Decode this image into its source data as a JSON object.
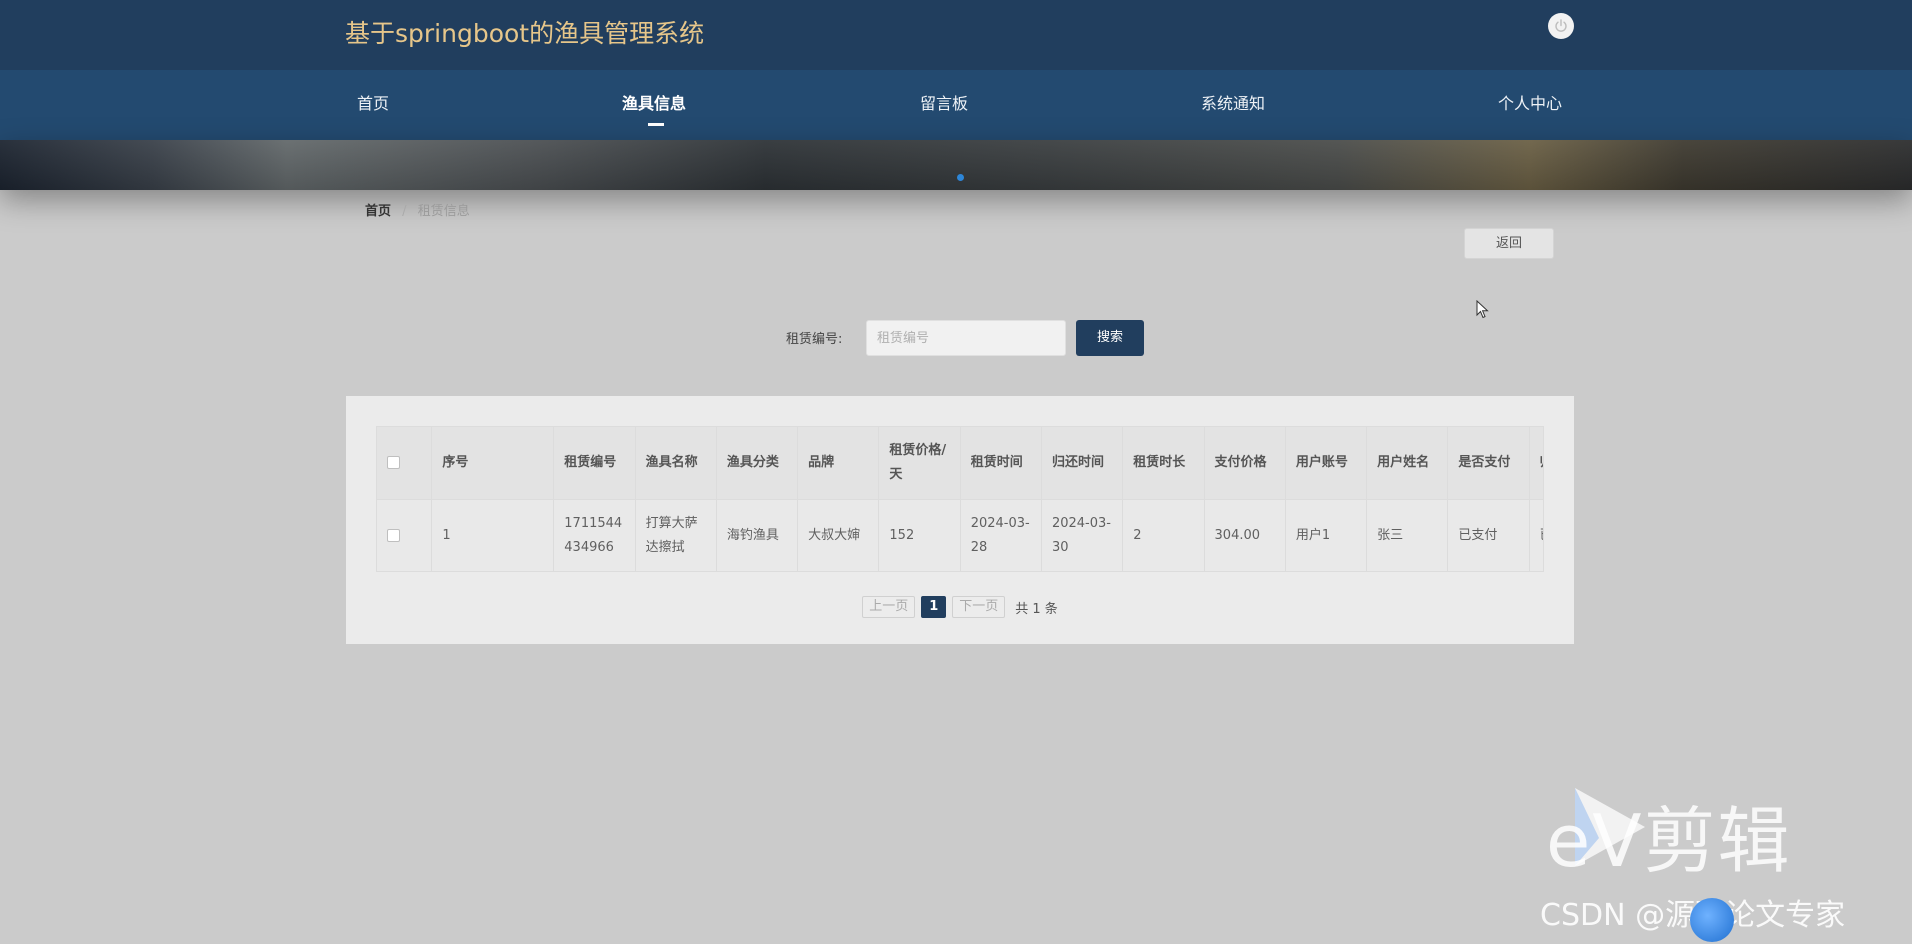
{
  "header": {
    "site_title": "基于springboot的渔具管理系统",
    "power_icon": "power-icon"
  },
  "nav": {
    "items": [
      {
        "label": "首页"
      },
      {
        "label": "渔具信息",
        "active": true
      },
      {
        "label": "留言板"
      },
      {
        "label": "系统通知"
      },
      {
        "label": "个人中心"
      }
    ]
  },
  "breadcrumb": {
    "home": "首页",
    "separator": "/",
    "current": "租赁信息"
  },
  "actions": {
    "back_label": "返回"
  },
  "search": {
    "label": "租赁编号:",
    "placeholder": "租赁编号",
    "value": "",
    "button_label": "搜索"
  },
  "table": {
    "headers": [
      "序号",
      "租赁编号",
      "渔具名称",
      "渔具分类",
      "品牌",
      "租赁价格/天",
      "租赁时间",
      "归还时间",
      "租赁时长",
      "支付价格",
      "用户账号",
      "用户姓名",
      "是否支付",
      "归还状态"
    ],
    "rows": [
      {
        "cells": [
          "1",
          "1711544434966",
          "打算大萨达擦拭",
          "海钓渔具",
          "大叔大婶",
          "152",
          "2024-03-28",
          "2024-03-30",
          "2",
          "304.00",
          "用户1",
          "张三",
          "已支付",
          "已归还"
        ]
      }
    ]
  },
  "pagination": {
    "prev_label": "上一页",
    "current_page": "1",
    "next_label": "下一页",
    "total_text": "共 1 条"
  },
  "watermark": {
    "brand": "eV剪辑",
    "credit": "CSDN @源码论文专家"
  },
  "colors": {
    "header_bg": "#213e5e",
    "nav_bg": "#234a70",
    "title_color": "#e6c68a",
    "page_bg": "#cbcbcb",
    "accent": "#213e5e"
  }
}
